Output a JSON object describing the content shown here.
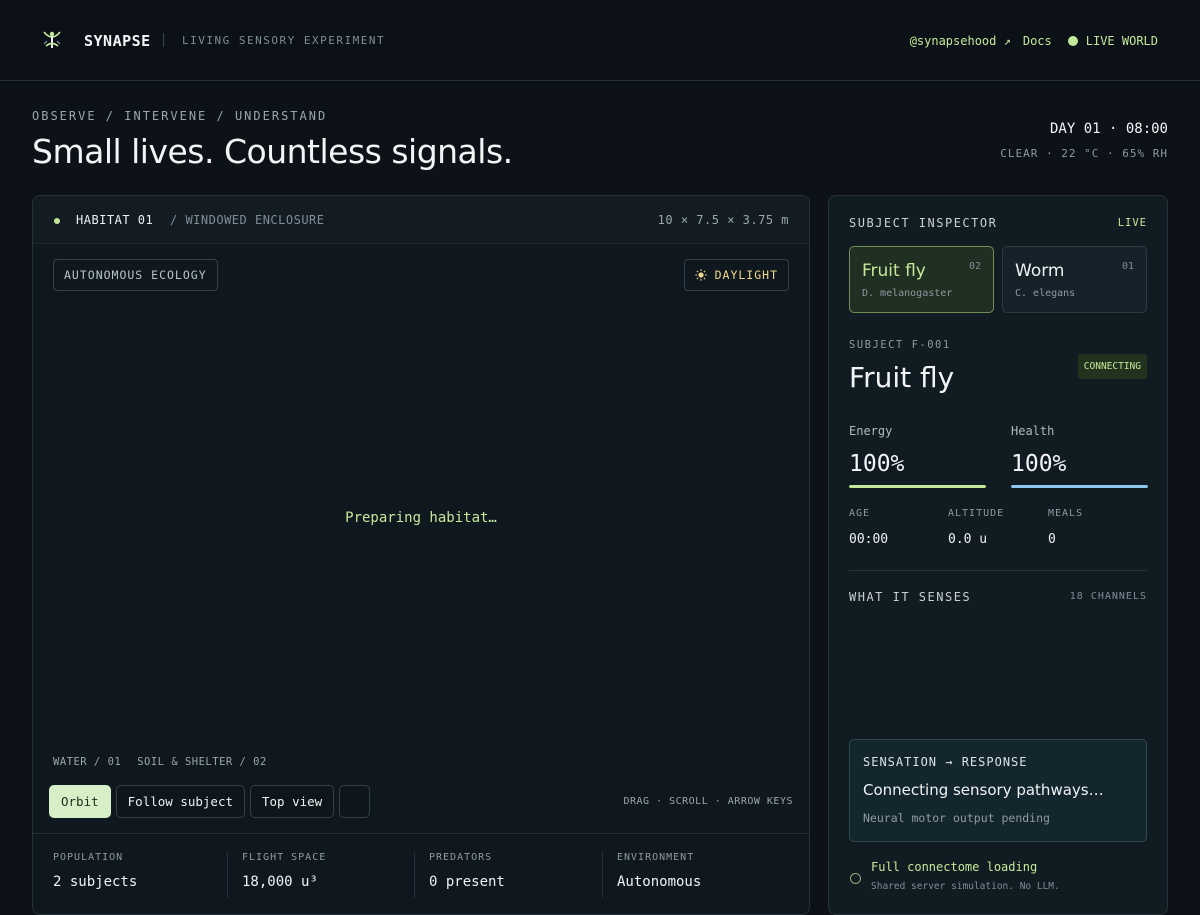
{
  "header": {
    "brand": "SYNAPSE",
    "tagline": "LIVING SENSORY EXPERIMENT",
    "social_link": "@synapsehood ↗",
    "docs_link": "Docs",
    "live_label": "LIVE WORLD",
    "accent_color": "#c4e89a"
  },
  "hero": {
    "eyebrow": "OBSERVE / INTERVENE / UNDERSTAND",
    "title": "Small lives. Countless signals.",
    "clock": "DAY 01 · 08:00",
    "weather": "CLEAR · 22 °C · 65% RH"
  },
  "habitat": {
    "name": "HABITAT 01",
    "subtitle": "/ WINDOWED ENCLOSURE",
    "dimensions": "10 × 7.5 × 3.75 m",
    "ecology_chip": "AUTONOMOUS ECOLOGY",
    "daylight_icon": "sun-icon",
    "daylight_chip": "DAYLIGHT",
    "status": "Preparing habitat…",
    "legend": [
      "WATER / 01",
      "SOIL & SHELTER / 02"
    ],
    "controls": {
      "orbit": "Orbit",
      "follow": "Follow subject",
      "top_view": "Top view",
      "active": "orbit"
    },
    "hint": "DRAG · SCROLL · ARROW KEYS",
    "stats": [
      {
        "label": "POPULATION",
        "value": "2 subjects"
      },
      {
        "label": "FLIGHT SPACE",
        "value": "18,000 u³"
      },
      {
        "label": "PREDATORS",
        "value": "0 present"
      },
      {
        "label": "ENVIRONMENT",
        "value": "Autonomous"
      }
    ]
  },
  "inspector": {
    "title": "SUBJECT INSPECTOR",
    "live": "LIVE",
    "species": [
      {
        "name": "Fruit fly",
        "count": "02",
        "scientific": "D. melanogaster",
        "selected": true
      },
      {
        "name": "Worm",
        "count": "01",
        "scientific": "C. elegans",
        "selected": false
      }
    ],
    "subject_id": "SUBJECT F-001",
    "subject_name": "Fruit fly",
    "status_badge": "CONNECTING",
    "energy": {
      "label": "Energy",
      "value": "100%",
      "level": 1.0,
      "color": "#c4e89a"
    },
    "health": {
      "label": "Health",
      "value": "100%",
      "level": 1.0,
      "color": "#8fc7ee"
    },
    "vitals": [
      {
        "label": "AGE",
        "value": "00:00"
      },
      {
        "label": "ALTITUDE",
        "value": "0.0 u"
      },
      {
        "label": "MEALS",
        "value": "0"
      }
    ],
    "senses_title": "WHAT IT SENSES",
    "channels": "18 CHANNELS",
    "sensation": {
      "title": "SENSATION → RESPONSE",
      "message": "Connecting sensory pathways…",
      "sub": "Neural motor output pending"
    },
    "loading": {
      "title": "Full connectome loading",
      "sub": "Shared server simulation. No LLM."
    }
  }
}
